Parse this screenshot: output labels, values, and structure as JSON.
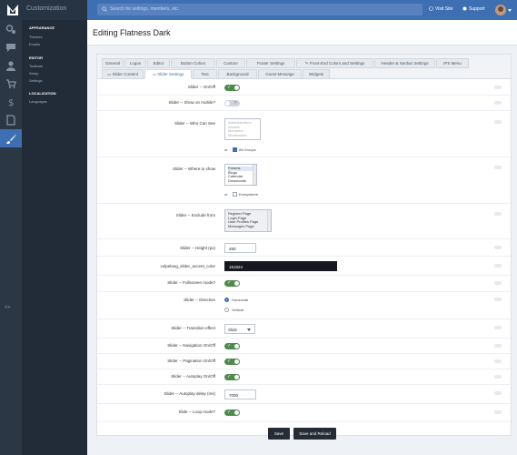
{
  "app": {
    "title": "Customization"
  },
  "search": {
    "placeholder": "Search for settings, members, etc."
  },
  "top_links": {
    "visit_site": "Visit Site",
    "support": "Support"
  },
  "subnav": {
    "sections": [
      {
        "heading": "APPEARANCE",
        "items": [
          "Themes",
          "Emails"
        ]
      },
      {
        "heading": "EDITOR",
        "items": [
          "Toolbars",
          "Setup",
          "Settings"
        ]
      },
      {
        "heading": "LOCALIZATION",
        "items": [
          "Languages"
        ]
      }
    ]
  },
  "page": {
    "title": "Editing Flatness Dark"
  },
  "tabs": {
    "row1": [
      "General",
      "Logos",
      "Editor",
      "Button Colors",
      "Custom",
      "Footer Settings",
      "Front-End Colors and Settings",
      "Header & Navbar Settings",
      "IPS Menu"
    ],
    "row2": [
      "Slider Content",
      "Slider Settings",
      "Text",
      "Background",
      "Guest Message",
      "Widgets"
    ],
    "selected": "Slider Settings"
  },
  "form": {
    "slider_on_off": {
      "label": "Slider -- On/Off",
      "value": true
    },
    "show_on_mobile": {
      "label": "Slider -- Show on mobile?",
      "value": false
    },
    "who_can_see": {
      "label": "Slider -- Who Can See",
      "options": [
        "Administrators",
        "Guests",
        "Members",
        "Moderators"
      ],
      "or_label": "or",
      "all_groups": "All Groups",
      "all_checked": true
    },
    "where_to_show": {
      "label": "Slider -- Where to show",
      "options": [
        "Forums",
        "Blogs",
        "Calendar",
        "Downloads"
      ],
      "or_label": "or",
      "everywhere": "Everywhere",
      "everywhere_checked": false
    },
    "exclude_from": {
      "label": "Slider -- Exclude from",
      "options": [
        "Register Page",
        "Login Page",
        "User Profiles Page",
        "Messages Page"
      ]
    },
    "height": {
      "label": "Slider -- Height (px)",
      "value": "450"
    },
    "accent_color": {
      "label": "volpelang_slider_accent_color",
      "value": "151824"
    },
    "fullscreen": {
      "label": "Slider -- Fullscreen mode?",
      "value": true
    },
    "direction": {
      "label": "Slider -- Direction",
      "options": [
        "Horizontal",
        "Vertical"
      ],
      "selected": "Horizontal"
    },
    "transition": {
      "label": "Slider -- Transition effect",
      "value": "Slide"
    },
    "navigation": {
      "label": "Slider -- Navigation On/Off",
      "value": true
    },
    "pagination": {
      "label": "Slider -- Pagination On/Off",
      "value": true
    },
    "autoplay": {
      "label": "Slider -- Autoplay On/Off",
      "value": true
    },
    "autoplay_delay": {
      "label": "Slider -- Autoplay delay (ms)",
      "value": "7000"
    },
    "loop": {
      "label": "Slide -- Loop mode?",
      "value": true
    }
  },
  "buttons": {
    "save": "Save",
    "save_reload": "Save and Reload"
  },
  "colors": {
    "topbar": "#3f6fb3",
    "sidebar": "#222c38",
    "toggle_on": "#4e8a4c",
    "accent_input": "#17171f"
  }
}
